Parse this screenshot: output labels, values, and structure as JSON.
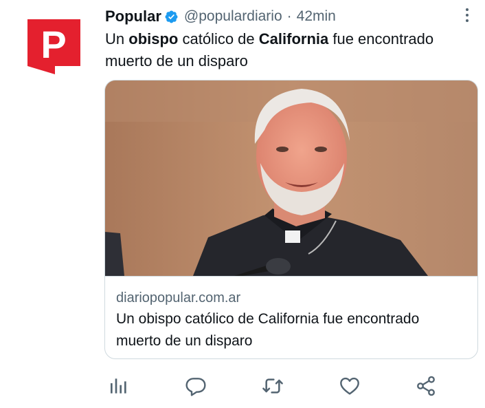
{
  "tweet": {
    "author_name": "Popular",
    "handle": "@populardiario",
    "separator": "·",
    "time": "42min",
    "avatar_letter": "P",
    "text_parts": {
      "p1": "Un ",
      "b1": "obispo",
      "p2": " católico de ",
      "b2": "California",
      "p3": " fue encontrado muerto de un disparo"
    }
  },
  "card": {
    "domain": "diariopopular.com.ar",
    "title": "Un obispo católico de California fue encontrado muerto de un disparo"
  },
  "actions": [
    {
      "icon": "analytics-icon"
    },
    {
      "icon": "reply-icon"
    },
    {
      "icon": "retweet-icon"
    },
    {
      "icon": "like-icon"
    },
    {
      "icon": "share-icon"
    }
  ],
  "colors": {
    "brand_red": "#e4202e",
    "verified_blue": "#1d9bf0",
    "text_primary": "#0f1419",
    "text_secondary": "#536471",
    "border": "#cfd9de"
  }
}
